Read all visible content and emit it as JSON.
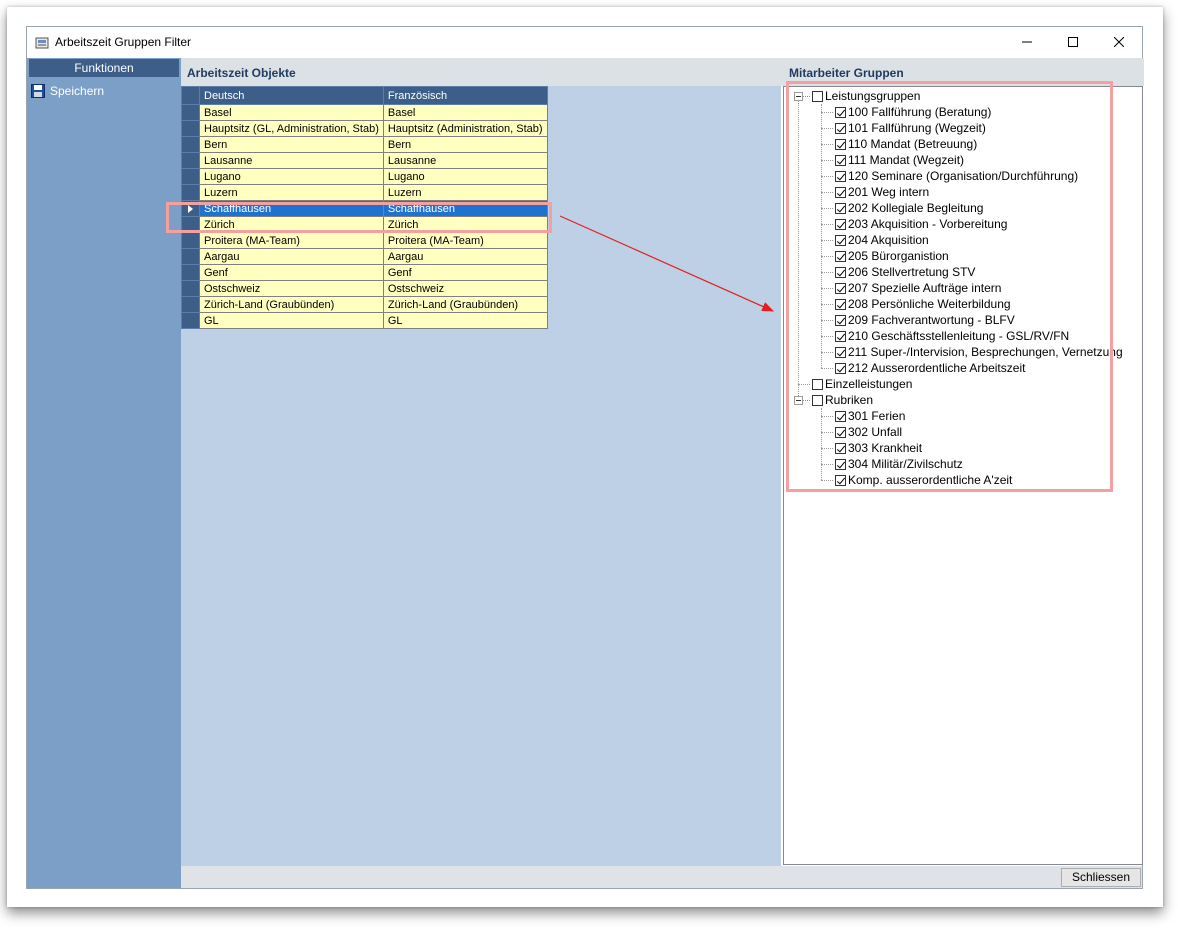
{
  "window": {
    "title": "Arbeitszeit Gruppen Filter"
  },
  "left_panel": {
    "header": "Funktionen",
    "items": [
      {
        "label": "Speichern",
        "icon": "save-icon"
      }
    ]
  },
  "objects": {
    "title": "Arbeitszeit Objekte",
    "columns": [
      "Deutsch",
      "Französisch"
    ],
    "rows": [
      [
        "Basel",
        "Basel"
      ],
      [
        "Hauptsitz (GL, Administration, Stab)",
        "Hauptsitz (Administration, Stab)"
      ],
      [
        "Bern",
        "Bern"
      ],
      [
        "Lausanne",
        "Lausanne"
      ],
      [
        "Lugano",
        "Lugano"
      ],
      [
        "Luzern",
        "Luzern"
      ],
      [
        "Schaffhausen",
        "Schaffhausen"
      ],
      [
        "Zürich",
        "Zürich"
      ],
      [
        "Proitera (MA-Team)",
        "Proitera (MA-Team)"
      ],
      [
        "Aargau",
        "Aargau"
      ],
      [
        "Genf",
        "Genf"
      ],
      [
        "Ostschweiz",
        "Ostschweiz"
      ],
      [
        "Zürich-Land (Graubünden)",
        "Zürich-Land (Graubünden)"
      ],
      [
        "GL",
        "GL"
      ]
    ],
    "selected_row": "Schaffhausen"
  },
  "groups": {
    "title": "Mitarbeiter Gruppen",
    "tree": [
      {
        "label": "Leistungsgruppen",
        "checked": false,
        "expanded": true,
        "children": [
          {
            "label": "100 Fallführung (Beratung)",
            "checked": true
          },
          {
            "label": "101 Fallführung (Wegzeit)",
            "checked": true
          },
          {
            "label": "110 Mandat (Betreuung)",
            "checked": true
          },
          {
            "label": "111 Mandat (Wegzeit)",
            "checked": true
          },
          {
            "label": "120 Seminare (Organisation/Durchführung)",
            "checked": true
          },
          {
            "label": "201 Weg intern",
            "checked": true
          },
          {
            "label": "202 Kollegiale Begleitung",
            "checked": true
          },
          {
            "label": "203 Akquisition - Vorbereitung",
            "checked": true
          },
          {
            "label": "204 Akquisition",
            "checked": true
          },
          {
            "label": "205 Bürorganistion",
            "checked": true
          },
          {
            "label": "206 Stellvertretung STV",
            "checked": true
          },
          {
            "label": "207 Spezielle Aufträge intern",
            "checked": true
          },
          {
            "label": "208 Persönliche Weiterbildung",
            "checked": true
          },
          {
            "label": "209 Fachverantwortung - BLFV",
            "checked": true
          },
          {
            "label": "210 Geschäftsstellenleitung - GSL/RV/FN",
            "checked": true
          },
          {
            "label": "211 Super-/Intervision, Besprechungen, Vernetzung",
            "checked": true
          },
          {
            "label": "212 Ausserordentliche Arbeitszeit",
            "checked": true
          }
        ]
      },
      {
        "label": "Einzelleistungen",
        "checked": false,
        "expanded": false,
        "children": []
      },
      {
        "label": "Rubriken",
        "checked": false,
        "expanded": true,
        "children": [
          {
            "label": "301 Ferien",
            "checked": true
          },
          {
            "label": "302 Unfall",
            "checked": true
          },
          {
            "label": "303 Krankheit",
            "checked": true
          },
          {
            "label": "304 Militär/Zivilschutz",
            "checked": true
          },
          {
            "label": "Komp. ausserordentliche A'zeit",
            "checked": true
          }
        ]
      }
    ]
  },
  "footer": {
    "close_label": "Schliessen"
  },
  "colors": {
    "header_blue": "#3c5e88",
    "cell_yellow": "#ffffc0",
    "selection_blue": "#1e73d0",
    "highlight_pink": "#f4a0a0",
    "arrow_red": "#e02020"
  }
}
